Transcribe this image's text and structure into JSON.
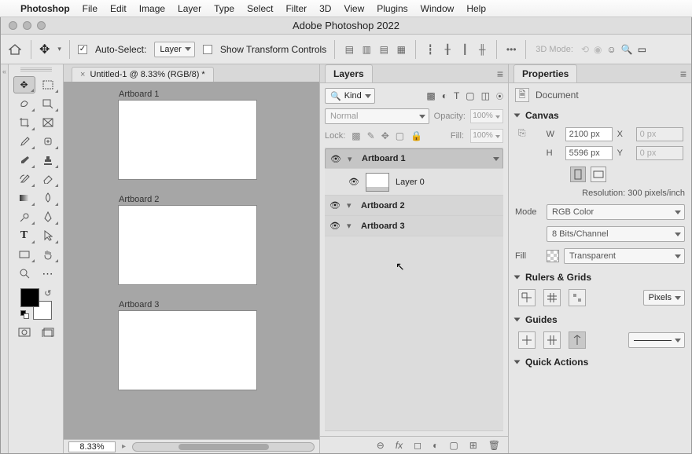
{
  "menubar": {
    "app": "Photoshop",
    "items": [
      "File",
      "Edit",
      "Image",
      "Layer",
      "Type",
      "Select",
      "Filter",
      "3D",
      "View",
      "Plugins",
      "Window",
      "Help"
    ]
  },
  "window_title": "Adobe Photoshop 2022",
  "options": {
    "auto_select_label": "Auto-Select:",
    "auto_select_target": "Layer",
    "show_transform": "Show Transform Controls",
    "mode3d": "3D Mode:"
  },
  "document": {
    "tab_title": "Untitled-1 @ 8.33% (RGB/8) *",
    "zoom": "8.33%",
    "artboards": [
      "Artboard 1",
      "Artboard 2",
      "Artboard 3"
    ]
  },
  "layers": {
    "tab": "Layers",
    "kind": "Kind",
    "blend": "Normal",
    "opacity_label": "Opacity:",
    "opacity_val": "100%",
    "lock_label": "Lock:",
    "fill_label": "Fill:",
    "fill_val": "100%",
    "items": [
      {
        "name": "Artboard 1",
        "child": "Layer 0"
      },
      {
        "name": "Artboard 2"
      },
      {
        "name": "Artboard 3"
      }
    ]
  },
  "properties": {
    "tab": "Properties",
    "doc_label": "Document",
    "canvas": {
      "title": "Canvas",
      "w_label": "W",
      "w_val": "2100 px",
      "h_label": "H",
      "h_val": "5596 px",
      "x_label": "X",
      "x_val": "0 px",
      "y_label": "Y",
      "y_val": "0 px",
      "resolution": "Resolution: 300 pixels/inch",
      "mode_label": "Mode",
      "mode_val": "RGB Color",
      "bits_val": "8 Bits/Channel",
      "fill_label": "Fill",
      "fill_val": "Transparent"
    },
    "rulers": {
      "title": "Rulers & Grids",
      "unit": "Pixels"
    },
    "guides": {
      "title": "Guides"
    },
    "quick": {
      "title": "Quick Actions"
    }
  }
}
